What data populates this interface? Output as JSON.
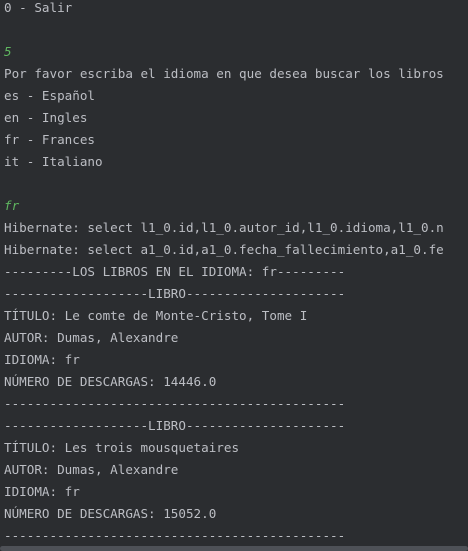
{
  "console": {
    "lines": [
      {
        "text": "0 - Salir",
        "kind": "output"
      },
      {
        "text": "",
        "kind": "empty"
      },
      {
        "text": "5",
        "kind": "input"
      },
      {
        "text": "Por favor escriba el idioma en que desea buscar los libros",
        "kind": "output"
      },
      {
        "text": "es - Español",
        "kind": "output"
      },
      {
        "text": "en - Ingles",
        "kind": "output"
      },
      {
        "text": "fr - Frances",
        "kind": "output"
      },
      {
        "text": "it - Italiano",
        "kind": "output"
      },
      {
        "text": "",
        "kind": "empty"
      },
      {
        "text": "fr",
        "kind": "input"
      },
      {
        "text": "Hibernate: select l1_0.id,l1_0.autor_id,l1_0.idioma,l1_0.n",
        "kind": "output"
      },
      {
        "text": "Hibernate: select a1_0.id,a1_0.fecha_fallecimiento,a1_0.fe",
        "kind": "output"
      },
      {
        "text": "---------LOS LIBROS EN EL IDIOMA: fr---------",
        "kind": "output"
      },
      {
        "text": "-------------------LIBRO---------------------",
        "kind": "output"
      },
      {
        "text": "TÍTULO: Le comte de Monte-Cristo, Tome I",
        "kind": "output"
      },
      {
        "text": "AUTOR: Dumas, Alexandre",
        "kind": "output"
      },
      {
        "text": "IDIOMA: fr",
        "kind": "output"
      },
      {
        "text": "NÚMERO DE DESCARGAS: 14446.0",
        "kind": "output"
      },
      {
        "text": "---------------------------------------------",
        "kind": "output"
      },
      {
        "text": "-------------------LIBRO---------------------",
        "kind": "output"
      },
      {
        "text": "TÍTULO: Les trois mousquetaires",
        "kind": "output"
      },
      {
        "text": "AUTOR: Dumas, Alexandre",
        "kind": "output"
      },
      {
        "text": "IDIOMA: fr",
        "kind": "output"
      },
      {
        "text": "NÚMERO DE DESCARGAS: 15052.0",
        "kind": "output"
      },
      {
        "text": "---------------------------------------------",
        "kind": "output"
      }
    ]
  },
  "colors": {
    "background": "#2b2d30",
    "output_text": "#bcbec4",
    "input_text": "#5fb760",
    "scrollbar_thumb": "#4e5157"
  }
}
